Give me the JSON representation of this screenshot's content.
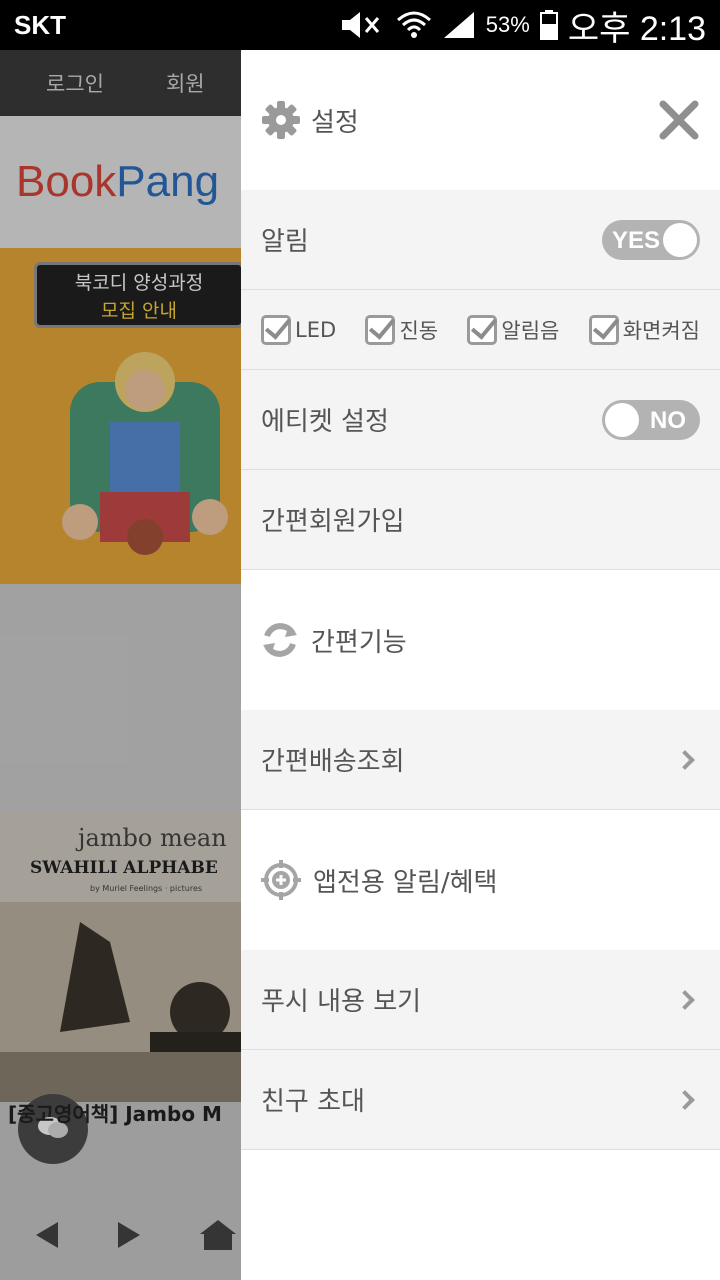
{
  "status_bar": {
    "carrier": "SKT",
    "battery": "53%",
    "time": "오후 2:13"
  },
  "background": {
    "tabs": [
      "로그인",
      "회원"
    ],
    "logo": {
      "part_a": "Book",
      "part_b": "Pang"
    },
    "banner": {
      "line1": "북코디 양성과정",
      "line2": "모집 안내"
    },
    "book": {
      "title1": "jambo mean",
      "title2": "SWAHILI ALPHABE",
      "title3": "by Muriel Feelings · pictures"
    },
    "product_title": "[중고영어책] Jambo M"
  },
  "drawer": {
    "title": "설정",
    "notification": {
      "label": "알림",
      "toggle": "YES"
    },
    "checkboxes": [
      "LED",
      "진동",
      "알림음",
      "화면켜짐"
    ],
    "etiquette": {
      "label": "에티켓 설정",
      "toggle": "NO"
    },
    "simple_signup": "간편회원가입",
    "simple_features": "간편기능",
    "delivery": "간편배송조회",
    "app_alerts": "앱전용 알림/혜택",
    "push_view": "푸시 내용 보기",
    "invite": "친구 초대"
  },
  "colors": {
    "drawer_bg": "#ffffff",
    "row_grey": "#f4f4f4",
    "text": "#555555",
    "toggle": "#b3b3b3"
  }
}
